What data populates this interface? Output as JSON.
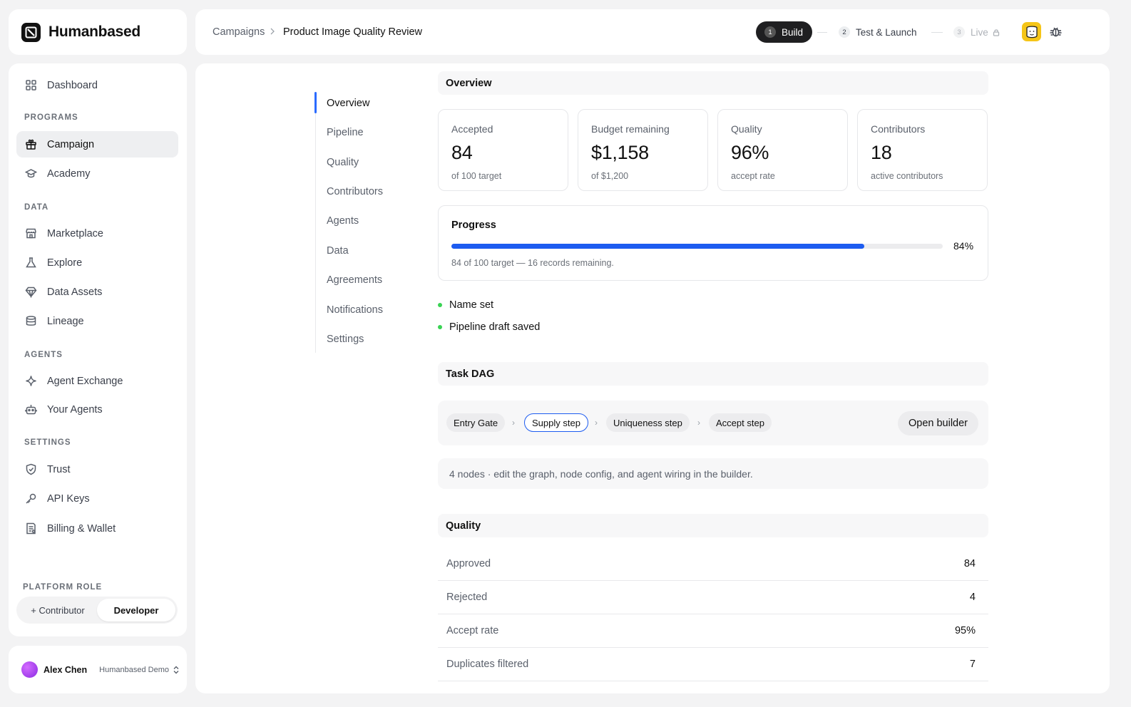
{
  "brand": {
    "name": "Humanbased"
  },
  "sidebar": {
    "items": [
      {
        "label": "Dashboard",
        "icon": "grid-icon"
      },
      {
        "label": "Campaign",
        "icon": "gift-icon",
        "active": true
      },
      {
        "label": "Academy",
        "icon": "graduation-cap-icon"
      },
      {
        "label": "Marketplace",
        "icon": "storefront-icon"
      },
      {
        "label": "Explore",
        "icon": "flask-icon"
      },
      {
        "label": "Data Assets",
        "icon": "diamond-icon"
      },
      {
        "label": "Lineage",
        "icon": "database-icon"
      },
      {
        "label": "Agent Exchange",
        "icon": "sparkle-icon"
      },
      {
        "label": "Your Agents",
        "icon": "robot-icon"
      },
      {
        "label": "Trust",
        "icon": "shield-icon"
      },
      {
        "label": "API Keys",
        "icon": "key-icon"
      },
      {
        "label": "Billing & Wallet",
        "icon": "receipt-icon"
      }
    ],
    "sections": [
      "PROGRAMS",
      "DATA",
      "AGENTS",
      "SETTINGS"
    ],
    "platform_role": {
      "label": "PLATFORM ROLE",
      "options": [
        "+ Contributor",
        "Developer"
      ],
      "selected": "Developer"
    }
  },
  "user": {
    "name": "Alex Chen",
    "org": "Humanbased Demo"
  },
  "header": {
    "breadcrumb": [
      "Campaigns",
      "Product Image Quality Review"
    ],
    "steps": [
      {
        "num": "1",
        "label": "Build",
        "state": "active"
      },
      {
        "num": "2",
        "label": "Test & Launch",
        "state": "pending"
      },
      {
        "num": "3",
        "label": "Live",
        "state": "locked"
      }
    ]
  },
  "subnav": [
    "Overview",
    "Pipeline",
    "Quality",
    "Contributors",
    "Agents",
    "Data",
    "Agreements",
    "Notifications",
    "Settings"
  ],
  "overview": {
    "title": "Overview",
    "stats": [
      {
        "label": "Accepted",
        "value": "84",
        "sub": "of 100 target"
      },
      {
        "label": "Budget remaining",
        "value": "$1,158",
        "sub": "of $1,200"
      },
      {
        "label": "Quality",
        "value": "96%",
        "sub": "accept rate"
      },
      {
        "label": "Contributors",
        "value": "18",
        "sub": "active contributors"
      }
    ],
    "progress": {
      "title": "Progress",
      "percent_label": "84%",
      "fraction": 0.84,
      "note": "84 of 100 target — 16 records remaining."
    },
    "checklist": [
      "Name set",
      "Pipeline draft saved"
    ]
  },
  "task_dag": {
    "title": "Task DAG",
    "nodes": [
      "Entry Gate",
      "Supply step",
      "Uniqueness step",
      "Accept step"
    ],
    "selected_node": "Supply step",
    "open_builder_label": "Open builder",
    "note": "4 nodes · edit the graph, node config, and agent wiring in the builder."
  },
  "quality": {
    "title": "Quality",
    "rows": [
      {
        "label": "Approved",
        "value": "84"
      },
      {
        "label": "Rejected",
        "value": "4"
      },
      {
        "label": "Accept rate",
        "value": "95%"
      },
      {
        "label": "Duplicates filtered",
        "value": "7"
      }
    ]
  },
  "colors": {
    "accent": "#1d5cf0",
    "success": "#39d353",
    "avatar_face": "#f5c518"
  }
}
